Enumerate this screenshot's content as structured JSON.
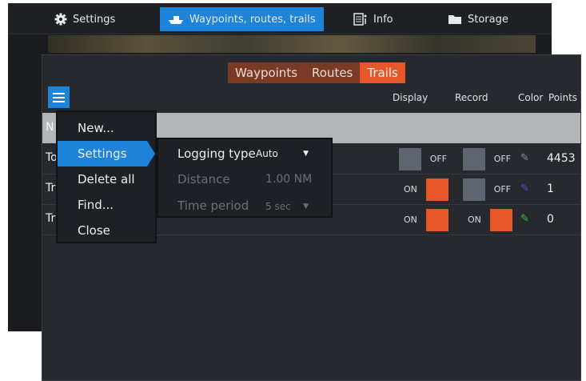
{
  "top_bar": {
    "tabs": [
      {
        "label": "Settings",
        "icon": "gear-icon"
      },
      {
        "label": "Waypoints, routes, trails",
        "icon": "boat-icon",
        "active": true
      },
      {
        "label": "Info",
        "icon": "info-icon"
      },
      {
        "label": "Storage",
        "icon": "folder-icon"
      }
    ]
  },
  "panel": {
    "tabs": [
      "Waypoints",
      "Routes",
      "Trails"
    ],
    "active_tab": "Trails",
    "columns": {
      "display": "Display",
      "record": "Record",
      "color": "Color",
      "points": "Points"
    },
    "header_initial": "N",
    "rows": [
      {
        "name_initial": "To",
        "display": "OFF",
        "record": "OFF",
        "color": "#2a2d32",
        "points": "4453"
      },
      {
        "name_initial": "Tr",
        "display": "ON",
        "record": "OFF",
        "color": "#3a35c8",
        "points": "1"
      },
      {
        "name_initial": "Tr",
        "display": "ON",
        "record": "ON",
        "color": "#36c23a",
        "points": "0"
      }
    ]
  },
  "context_menu": {
    "items": [
      "New...",
      "Settings",
      "Delete all",
      "Find...",
      "Close"
    ],
    "active": "Settings"
  },
  "settings_submenu": {
    "logging_type_label": "Logging type",
    "logging_type_value": "Auto",
    "distance_label": "Distance",
    "distance_value": "1.00 NM",
    "time_period_label": "Time period",
    "time_period_value": "5 sec"
  },
  "colors": {
    "accent": "#1d84d9",
    "tab_active": "#e8572a",
    "tab_inactive": "#7a3a28",
    "toggle_on": "#e8572a"
  }
}
